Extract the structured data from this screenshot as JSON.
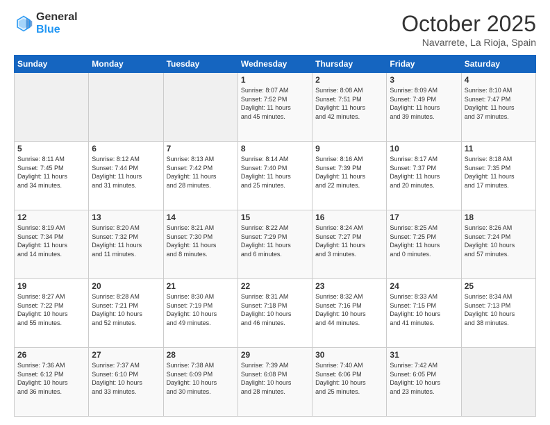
{
  "header": {
    "logo_general": "General",
    "logo_blue": "Blue",
    "month_title": "October 2025",
    "location": "Navarrete, La Rioja, Spain"
  },
  "calendar": {
    "days_of_week": [
      "Sunday",
      "Monday",
      "Tuesday",
      "Wednesday",
      "Thursday",
      "Friday",
      "Saturday"
    ],
    "weeks": [
      [
        {
          "day": "",
          "content": ""
        },
        {
          "day": "",
          "content": ""
        },
        {
          "day": "",
          "content": ""
        },
        {
          "day": "1",
          "content": "Sunrise: 8:07 AM\nSunset: 7:52 PM\nDaylight: 11 hours\nand 45 minutes."
        },
        {
          "day": "2",
          "content": "Sunrise: 8:08 AM\nSunset: 7:51 PM\nDaylight: 11 hours\nand 42 minutes."
        },
        {
          "day": "3",
          "content": "Sunrise: 8:09 AM\nSunset: 7:49 PM\nDaylight: 11 hours\nand 39 minutes."
        },
        {
          "day": "4",
          "content": "Sunrise: 8:10 AM\nSunset: 7:47 PM\nDaylight: 11 hours\nand 37 minutes."
        }
      ],
      [
        {
          "day": "5",
          "content": "Sunrise: 8:11 AM\nSunset: 7:45 PM\nDaylight: 11 hours\nand 34 minutes."
        },
        {
          "day": "6",
          "content": "Sunrise: 8:12 AM\nSunset: 7:44 PM\nDaylight: 11 hours\nand 31 minutes."
        },
        {
          "day": "7",
          "content": "Sunrise: 8:13 AM\nSunset: 7:42 PM\nDaylight: 11 hours\nand 28 minutes."
        },
        {
          "day": "8",
          "content": "Sunrise: 8:14 AM\nSunset: 7:40 PM\nDaylight: 11 hours\nand 25 minutes."
        },
        {
          "day": "9",
          "content": "Sunrise: 8:16 AM\nSunset: 7:39 PM\nDaylight: 11 hours\nand 22 minutes."
        },
        {
          "day": "10",
          "content": "Sunrise: 8:17 AM\nSunset: 7:37 PM\nDaylight: 11 hours\nand 20 minutes."
        },
        {
          "day": "11",
          "content": "Sunrise: 8:18 AM\nSunset: 7:35 PM\nDaylight: 11 hours\nand 17 minutes."
        }
      ],
      [
        {
          "day": "12",
          "content": "Sunrise: 8:19 AM\nSunset: 7:34 PM\nDaylight: 11 hours\nand 14 minutes."
        },
        {
          "day": "13",
          "content": "Sunrise: 8:20 AM\nSunset: 7:32 PM\nDaylight: 11 hours\nand 11 minutes."
        },
        {
          "day": "14",
          "content": "Sunrise: 8:21 AM\nSunset: 7:30 PM\nDaylight: 11 hours\nand 8 minutes."
        },
        {
          "day": "15",
          "content": "Sunrise: 8:22 AM\nSunset: 7:29 PM\nDaylight: 11 hours\nand 6 minutes."
        },
        {
          "day": "16",
          "content": "Sunrise: 8:24 AM\nSunset: 7:27 PM\nDaylight: 11 hours\nand 3 minutes."
        },
        {
          "day": "17",
          "content": "Sunrise: 8:25 AM\nSunset: 7:25 PM\nDaylight: 11 hours\nand 0 minutes."
        },
        {
          "day": "18",
          "content": "Sunrise: 8:26 AM\nSunset: 7:24 PM\nDaylight: 10 hours\nand 57 minutes."
        }
      ],
      [
        {
          "day": "19",
          "content": "Sunrise: 8:27 AM\nSunset: 7:22 PM\nDaylight: 10 hours\nand 55 minutes."
        },
        {
          "day": "20",
          "content": "Sunrise: 8:28 AM\nSunset: 7:21 PM\nDaylight: 10 hours\nand 52 minutes."
        },
        {
          "day": "21",
          "content": "Sunrise: 8:30 AM\nSunset: 7:19 PM\nDaylight: 10 hours\nand 49 minutes."
        },
        {
          "day": "22",
          "content": "Sunrise: 8:31 AM\nSunset: 7:18 PM\nDaylight: 10 hours\nand 46 minutes."
        },
        {
          "day": "23",
          "content": "Sunrise: 8:32 AM\nSunset: 7:16 PM\nDaylight: 10 hours\nand 44 minutes."
        },
        {
          "day": "24",
          "content": "Sunrise: 8:33 AM\nSunset: 7:15 PM\nDaylight: 10 hours\nand 41 minutes."
        },
        {
          "day": "25",
          "content": "Sunrise: 8:34 AM\nSunset: 7:13 PM\nDaylight: 10 hours\nand 38 minutes."
        }
      ],
      [
        {
          "day": "26",
          "content": "Sunrise: 7:36 AM\nSunset: 6:12 PM\nDaylight: 10 hours\nand 36 minutes."
        },
        {
          "day": "27",
          "content": "Sunrise: 7:37 AM\nSunset: 6:10 PM\nDaylight: 10 hours\nand 33 minutes."
        },
        {
          "day": "28",
          "content": "Sunrise: 7:38 AM\nSunset: 6:09 PM\nDaylight: 10 hours\nand 30 minutes."
        },
        {
          "day": "29",
          "content": "Sunrise: 7:39 AM\nSunset: 6:08 PM\nDaylight: 10 hours\nand 28 minutes."
        },
        {
          "day": "30",
          "content": "Sunrise: 7:40 AM\nSunset: 6:06 PM\nDaylight: 10 hours\nand 25 minutes."
        },
        {
          "day": "31",
          "content": "Sunrise: 7:42 AM\nSunset: 6:05 PM\nDaylight: 10 hours\nand 23 minutes."
        },
        {
          "day": "",
          "content": ""
        }
      ]
    ]
  }
}
